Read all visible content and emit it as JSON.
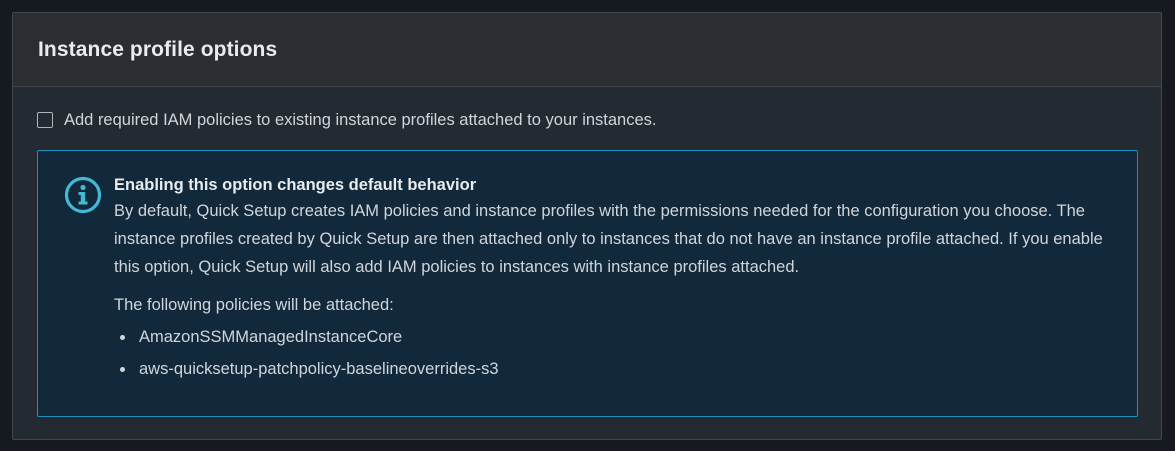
{
  "panel": {
    "title": "Instance profile options"
  },
  "option": {
    "checked": false,
    "label": "Add required IAM policies to existing instance profiles attached to your instances."
  },
  "alert": {
    "icon": "info-icon",
    "heading": "Enabling this option changes default behavior",
    "body": "By default, Quick Setup creates IAM policies and instance profiles with the permissions needed for the configuration you choose. The instance profiles created by Quick Setup are then attached only to instances that do not have an instance profile attached. If you enable this option, Quick Setup will also add IAM policies to instances with instance profiles attached.",
    "policies_intro": "The following policies will be attached:",
    "policies": [
      "AmazonSSMManagedInstanceCore",
      "aws-quicksetup-patchpolicy-baselineoverrides-s3"
    ]
  },
  "colors": {
    "background": "#16191f",
    "panel": "#232a32",
    "alert_background": "#12293b",
    "alert_border": "#1d8fbf",
    "info_icon": "#44b9d6"
  }
}
